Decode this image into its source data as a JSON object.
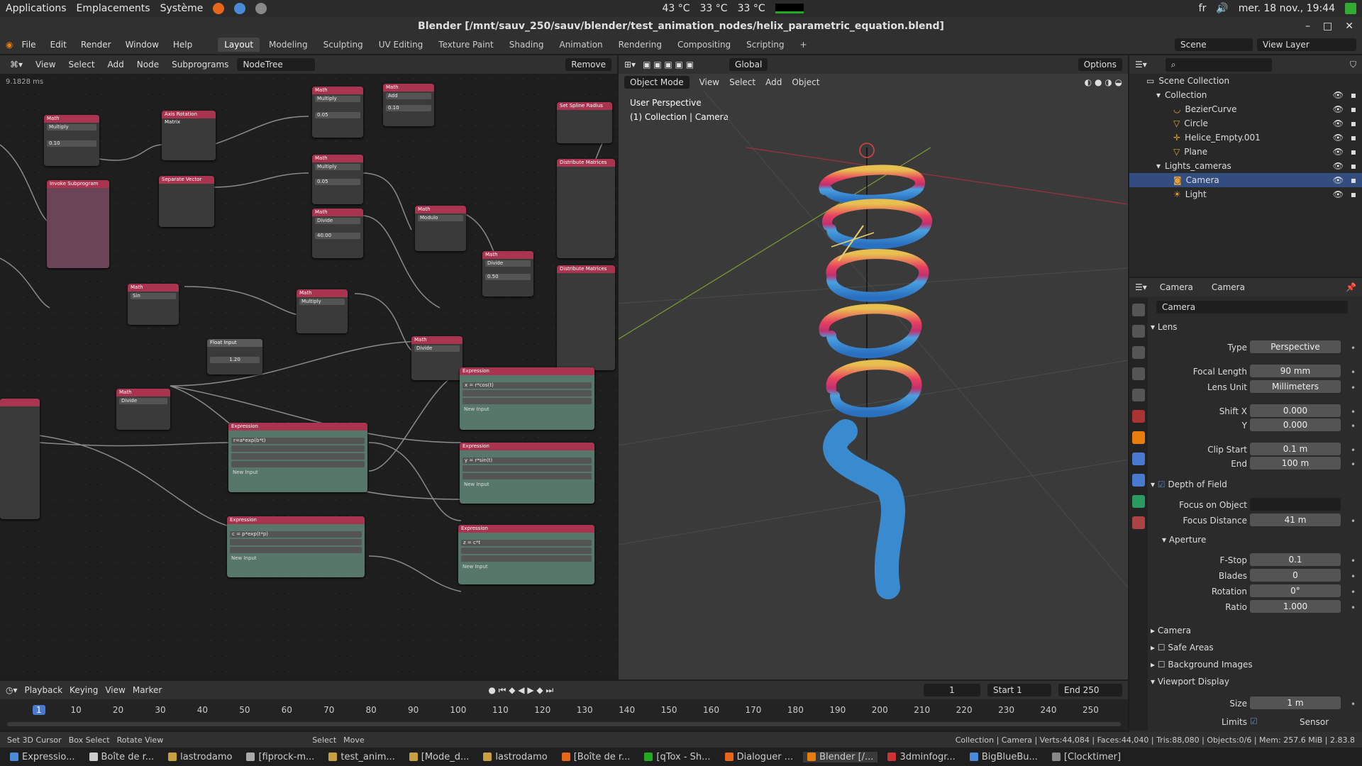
{
  "os_bar": {
    "applications": "Applications",
    "places": "Emplacements",
    "system": "Système",
    "temps": [
      "43 °C",
      "33 °C",
      "33 °C"
    ],
    "lang": "fr",
    "datetime": "mer. 18 nov., 19:44"
  },
  "window": {
    "title": "Blender [/mnt/sauv_250/sauv/blender/test_animation_nodes/helix_parametric_equation.blend]"
  },
  "menu": {
    "items": [
      "File",
      "Edit",
      "Render",
      "Window",
      "Help"
    ],
    "workspaces": [
      "Layout",
      "Modeling",
      "Sculpting",
      "UV Editing",
      "Texture Paint",
      "Shading",
      "Animation",
      "Rendering",
      "Compositing",
      "Scripting"
    ],
    "plus": "+",
    "scene": "Scene",
    "view_layer": "View Layer"
  },
  "node_editor": {
    "menus": [
      "View",
      "Select",
      "Add",
      "Node",
      "Subprograms"
    ],
    "tree": "NodeTree",
    "remove": "Remove",
    "timing": "9.1828 ms",
    "math_nodes": [
      {
        "title": "Math",
        "op": "Multiply",
        "val": "0.10"
      },
      {
        "title": "Math",
        "op": "Multiply",
        "val": "0.05"
      },
      {
        "title": "Math",
        "op": "Add",
        "val": "0.10"
      },
      {
        "title": "Math",
        "op": "Multiply",
        "val": "0.05"
      },
      {
        "title": "Math",
        "op": "Divide",
        "val": "40.00"
      },
      {
        "title": "Math",
        "op": "Modulo",
        "val": ""
      },
      {
        "title": "Math",
        "op": "Divide",
        "val": "0.50"
      },
      {
        "title": "Math",
        "op": "Sin",
        "val": ""
      },
      {
        "title": "Math",
        "op": "Multiply",
        "val": ""
      },
      {
        "title": "Math",
        "op": "Divide",
        "val": ""
      },
      {
        "title": "Math",
        "op": "Divide",
        "val": ""
      }
    ],
    "other_nodes": {
      "rotation": "Axis Rotation Matrix",
      "separate": "Separate Vector",
      "invoke": "Invoke Subprogram",
      "spline": "Set Spline Radius",
      "float_input": "Float Input",
      "float_val": "1.20",
      "distribute": "Distribute Matrices"
    },
    "expressions": [
      {
        "title": "Expression",
        "expr": "x = r*cos(t)"
      },
      {
        "title": "Expression",
        "expr": "r=a*exp(b*t)"
      },
      {
        "title": "Expression",
        "expr": "y = r*sin(t)"
      },
      {
        "title": "Expression",
        "expr": "c = p*exp(t*p)"
      },
      {
        "title": "Expression",
        "expr": "z = c*t"
      }
    ],
    "new_input": "New Input"
  },
  "viewport": {
    "mode": "Object Mode",
    "menus": [
      "View",
      "Select",
      "Add",
      "Object"
    ],
    "orientation": "Global",
    "options": "Options",
    "perspective": "User Perspective",
    "collection": "(1) Collection | Camera"
  },
  "outliner": {
    "root": "Scene Collection",
    "items": [
      {
        "name": "Collection",
        "level": 1
      },
      {
        "name": "BezierCurve",
        "level": 2
      },
      {
        "name": "Circle",
        "level": 2
      },
      {
        "name": "Helice_Empty.001",
        "level": 2
      },
      {
        "name": "Plane",
        "level": 2
      },
      {
        "name": "Lights_cameras",
        "level": 1
      },
      {
        "name": "Camera",
        "level": 2
      },
      {
        "name": "Light",
        "level": 2
      }
    ]
  },
  "properties": {
    "tab1": "Camera",
    "tab2": "Camera",
    "data_name": "Camera",
    "lens": "Lens",
    "rows": [
      {
        "label": "Type",
        "value": "Perspective"
      },
      {
        "label": "Focal Length",
        "value": "90 mm"
      },
      {
        "label": "Lens Unit",
        "value": "Millimeters"
      },
      {
        "label": "Shift X",
        "value": "0.000"
      },
      {
        "label": "Y",
        "value": "0.000"
      },
      {
        "label": "Clip Start",
        "value": "0.1 m"
      },
      {
        "label": "End",
        "value": "100 m"
      }
    ],
    "dof": "Depth of Field",
    "dof_rows": [
      {
        "label": "Focus on Object",
        "value": ""
      },
      {
        "label": "Focus Distance",
        "value": "41 m"
      }
    ],
    "aperture": "Aperture",
    "ap_rows": [
      {
        "label": "F-Stop",
        "value": "0.1"
      },
      {
        "label": "Blades",
        "value": "0"
      },
      {
        "label": "Rotation",
        "value": "0°"
      },
      {
        "label": "Ratio",
        "value": "1.000"
      }
    ],
    "sections": [
      "Camera",
      "Safe Areas",
      "Background Images",
      "Viewport Display"
    ],
    "size_label": "Size",
    "size_value": "1 m",
    "limits": "Limits",
    "sensor": "Sensor"
  },
  "timeline": {
    "menus": [
      "Playback",
      "Keying",
      "View",
      "Marker"
    ],
    "current": "1",
    "start_label": "Start",
    "start": "1",
    "end_label": "End",
    "end": "250",
    "ticks": [
      "1",
      "10",
      "20",
      "30",
      "40",
      "50",
      "60",
      "70",
      "80",
      "90",
      "100",
      "110",
      "120",
      "130",
      "140",
      "150",
      "160",
      "170",
      "180",
      "190",
      "200",
      "210",
      "220",
      "230",
      "240",
      "250"
    ]
  },
  "status": {
    "left": [
      "Set 3D Cursor",
      "Box Select",
      "Rotate View",
      "Select",
      "Move"
    ],
    "right": "Collection | Camera | Verts:44,084 | Faces:44,040 | Tris:88,080 | Objects:0/6 | Mem: 257.6 MiB | 2.83.8"
  },
  "taskbar": [
    "Expressio...",
    "Boîte de r...",
    "lastrodamo",
    "[fiprock-m...",
    "test_anim...",
    "[Mode_d...",
    "lastrodamo",
    "[Boîte de r...",
    "[qTox - Sh...",
    "Dialoguer ...",
    "Blender [/...",
    "3dminfogr...",
    "BigBlueBu...",
    "[Clocktimer]"
  ]
}
